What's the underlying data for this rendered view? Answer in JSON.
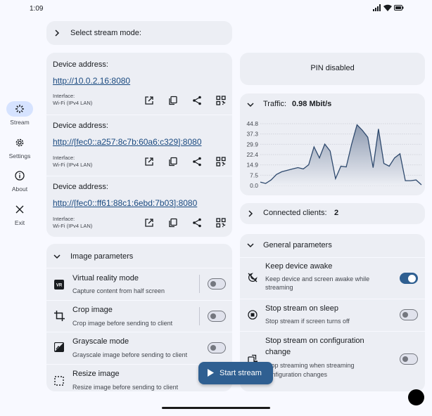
{
  "status": {
    "time": "1:09"
  },
  "nav": {
    "items": [
      {
        "label": "Stream",
        "icon": "stream-icon",
        "active": true
      },
      {
        "label": "Settings",
        "icon": "settings-icon",
        "active": false
      },
      {
        "label": "About",
        "icon": "info-icon",
        "active": false
      },
      {
        "label": "Exit",
        "icon": "close-icon",
        "active": false
      }
    ]
  },
  "stream_mode": {
    "label": "Select stream mode:"
  },
  "addresses": [
    {
      "label": "Device address:",
      "url": "http://10.0.2.16:8080",
      "iface_1": "Interface:",
      "iface_2": "Wi-Fi (IPv4 LAN)"
    },
    {
      "label": "Device address:",
      "url": "http://[fec0::a257:8c7b:60a6:c329]:8080",
      "iface_1": "Interface:",
      "iface_2": "Wi-Fi (IPv4 LAN)"
    },
    {
      "label": "Device address:",
      "url": "http://[fec0::ff61:88c1:6ebd:7b03]:8080",
      "iface_1": "Interface:",
      "iface_2": "Wi-Fi (IPv4 LAN)"
    }
  ],
  "image_params": {
    "header": "Image parameters",
    "rows": [
      {
        "title": "Virtual reality mode",
        "subtitle": "Capture content from half screen",
        "enabled": false
      },
      {
        "title": "Crop image",
        "subtitle": "Crop image before sending to client",
        "enabled": false
      },
      {
        "title": "Grayscale mode",
        "subtitle": "Grayscale image before sending to client",
        "enabled": false
      },
      {
        "title": "Resize image",
        "subtitle": "Resize image before sending to client",
        "enabled": false
      }
    ]
  },
  "pin": {
    "text": "PIN disabled"
  },
  "traffic": {
    "label": "Traffic:",
    "value": "0.98 Mbit/s"
  },
  "chart_data": {
    "type": "area",
    "y_ticks": [
      "44.8",
      "37.3",
      "29.9",
      "22.4",
      "14.9",
      "7.5",
      "0.0"
    ],
    "ylim": [
      0,
      44.8
    ],
    "grid": true,
    "values": [
      2.5,
      1.5,
      4,
      8,
      10,
      11,
      12,
      13,
      12,
      15,
      28,
      20,
      30,
      25,
      5,
      14,
      13.5,
      30,
      44,
      40,
      35,
      13,
      41,
      16,
      14,
      20,
      23,
      3.5,
      3.5,
      4,
      0.5
    ]
  },
  "clients": {
    "label": "Connected clients:",
    "count": "2"
  },
  "general": {
    "header": "General parameters",
    "rows": [
      {
        "title": "Keep device awake",
        "subtitle_1": "Keep device and screen awake while",
        "subtitle_2": "streaming",
        "enabled": true
      },
      {
        "title": "Stop stream on sleep",
        "subtitle_1": "Stop stream if screen turns off",
        "subtitle_2": "",
        "enabled": false
      },
      {
        "title_1": "Stop stream on configuration",
        "title_2": "change",
        "subtitle_1": "Stop streaming when streaming",
        "subtitle_2": "configuration changes",
        "enabled": false
      }
    ]
  },
  "fab": {
    "label": "Start stream"
  }
}
